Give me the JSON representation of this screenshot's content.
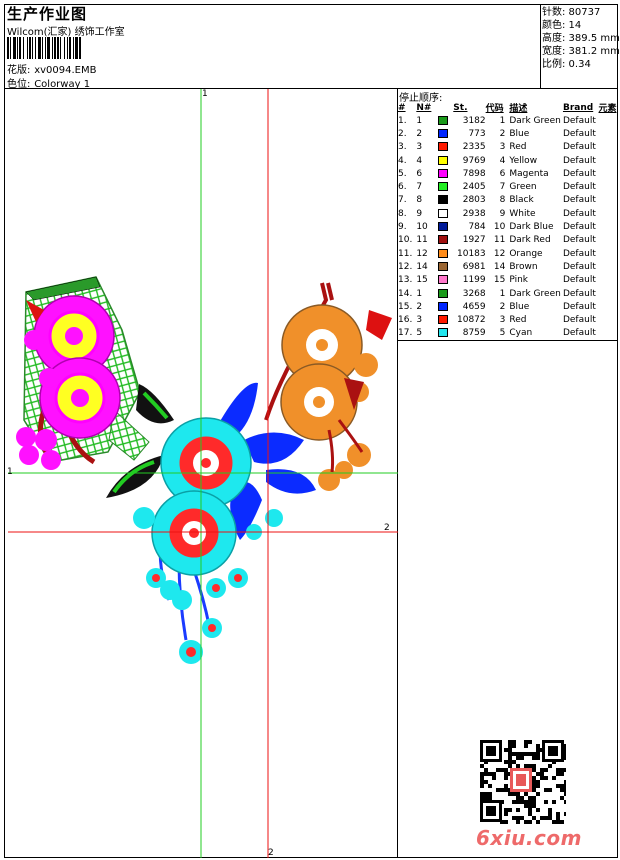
{
  "header": {
    "title": "生产作业图",
    "company": "Wilcom(汇家) 绣饰工作室",
    "design_label": "花版:",
    "design_value": "xv0094.EMB",
    "colorway_label": "色位:",
    "colorway_value": "Colorway 1"
  },
  "stats": {
    "stitches": "针数: 80737",
    "colors": "颜色: 14",
    "height": "高度: 389.5 mm",
    "width": "宽度: 381.2 mm",
    "scale": "比例: 0.34"
  },
  "stop_sequence": {
    "title": "停止顺序:",
    "headers": [
      "#",
      "N#",
      "St.",
      "代码",
      "描述",
      "Brand",
      "元素"
    ],
    "rows": [
      {
        "seq": "1.",
        "n": "1",
        "color": "#1a9a1a",
        "st": "3182",
        "code": "1",
        "desc": "Dark Green",
        "brand": "Default"
      },
      {
        "seq": "2.",
        "n": "2",
        "color": "#0026ff",
        "st": "773",
        "code": "2",
        "desc": "Blue",
        "brand": "Default"
      },
      {
        "seq": "3.",
        "n": "3",
        "color": "#ff1a00",
        "st": "2335",
        "code": "3",
        "desc": "Red",
        "brand": "Default"
      },
      {
        "seq": "4.",
        "n": "4",
        "color": "#ffff00",
        "st": "9769",
        "code": "4",
        "desc": "Yellow",
        "brand": "Default"
      },
      {
        "seq": "5.",
        "n": "6",
        "color": "#ff00ff",
        "st": "7898",
        "code": "6",
        "desc": "Magenta",
        "brand": "Default"
      },
      {
        "seq": "6.",
        "n": "7",
        "color": "#22ee22",
        "st": "2405",
        "code": "7",
        "desc": "Green",
        "brand": "Default"
      },
      {
        "seq": "7.",
        "n": "8",
        "color": "#000000",
        "st": "2803",
        "code": "8",
        "desc": "Black",
        "brand": "Default"
      },
      {
        "seq": "8.",
        "n": "9",
        "color": "#ffffff",
        "st": "2938",
        "code": "9",
        "desc": "White",
        "brand": "Default"
      },
      {
        "seq": "9.",
        "n": "10",
        "color": "#001a99",
        "st": "784",
        "code": "10",
        "desc": "Dark Blue",
        "brand": "Default"
      },
      {
        "seq": "10.",
        "n": "11",
        "color": "#a01010",
        "st": "1927",
        "code": "11",
        "desc": "Dark Red",
        "brand": "Default"
      },
      {
        "seq": "11.",
        "n": "12",
        "color": "#ff8c1a",
        "st": "10183",
        "code": "12",
        "desc": "Orange",
        "brand": "Default"
      },
      {
        "seq": "12.",
        "n": "14",
        "color": "#9a6633",
        "st": "6981",
        "code": "14",
        "desc": "Brown",
        "brand": "Default"
      },
      {
        "seq": "13.",
        "n": "15",
        "color": "#ff77cc",
        "st": "1199",
        "code": "15",
        "desc": "Pink",
        "brand": "Default"
      },
      {
        "seq": "14.",
        "n": "1",
        "color": "#1a9a1a",
        "st": "3268",
        "code": "1",
        "desc": "Dark Green",
        "brand": "Default"
      },
      {
        "seq": "15.",
        "n": "2",
        "color": "#0026ff",
        "st": "4659",
        "code": "2",
        "desc": "Blue",
        "brand": "Default"
      },
      {
        "seq": "16.",
        "n": "3",
        "color": "#ff1a00",
        "st": "10872",
        "code": "3",
        "desc": "Red",
        "brand": "Default"
      },
      {
        "seq": "17.",
        "n": "5",
        "color": "#22e6ee",
        "st": "8759",
        "code": "5",
        "desc": "Cyan",
        "brand": "Default"
      }
    ]
  },
  "axes": {
    "green_top": "1",
    "green_left": "1",
    "red_right": "2",
    "red_bottom": "2"
  },
  "watermark": {
    "text": "6xiu.com"
  }
}
